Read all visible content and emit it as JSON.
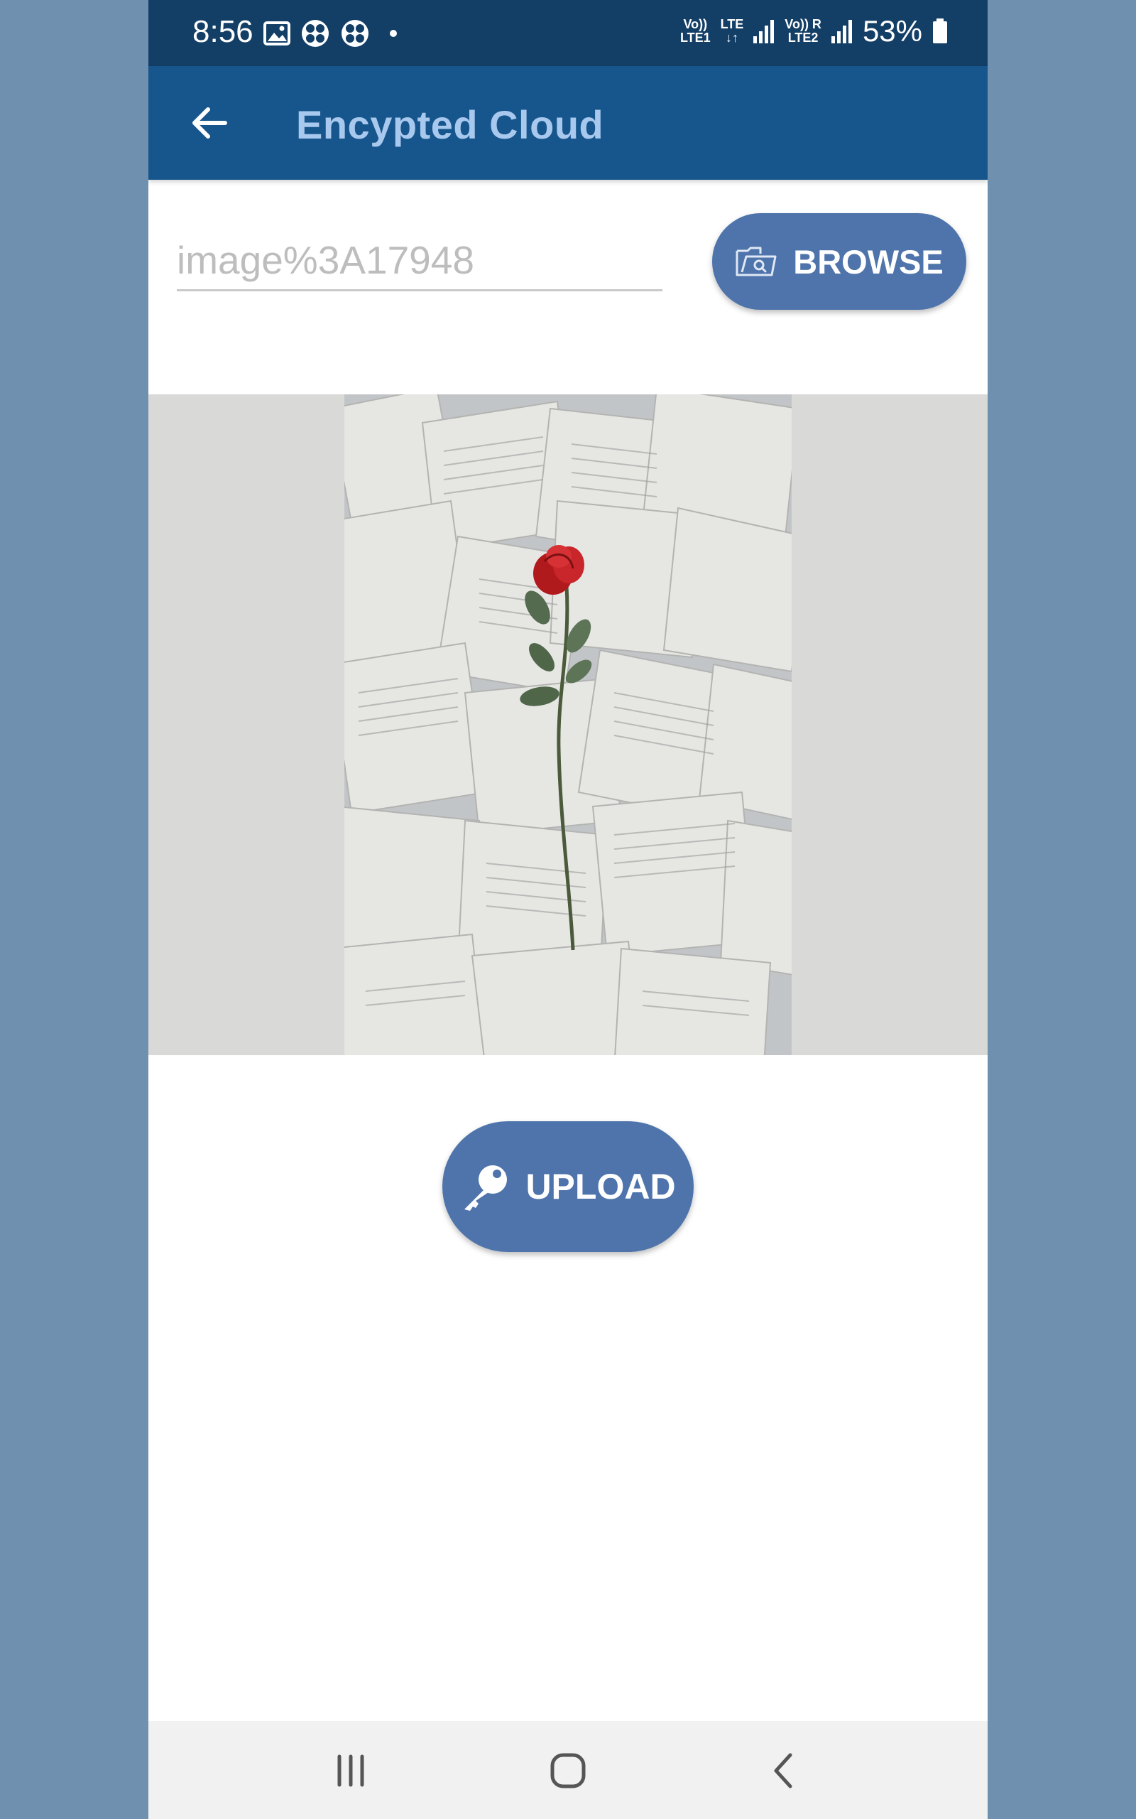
{
  "status_bar": {
    "time": "8:56",
    "net1_top": "Vo))",
    "net1_bottom": "LTE1",
    "lte_top": "LTE",
    "lte_bottom": "↓↑",
    "net2_top": "Vo)) R",
    "net2_bottom": "LTE2",
    "battery": "53%"
  },
  "app_bar": {
    "title": "Encypted Cloud",
    "back_icon": "arrow-back-icon"
  },
  "file_picker": {
    "value": "image%3A17948",
    "browse_label": "BROWSE",
    "browse_icon": "folder-search-icon"
  },
  "preview": {
    "subject": "red rose on scattered book pages"
  },
  "upload": {
    "label": "UPLOAD",
    "icon": "key-icon"
  },
  "nav_bar": {
    "recents_icon": "recents-icon",
    "home_icon": "home-icon",
    "back_icon": "nav-back-icon"
  },
  "colors": {
    "status_bar": "#133e66",
    "app_bar": "#16568c",
    "title": "#a8c8ee",
    "button": "#4e74ab",
    "outside": "#7090b0"
  }
}
